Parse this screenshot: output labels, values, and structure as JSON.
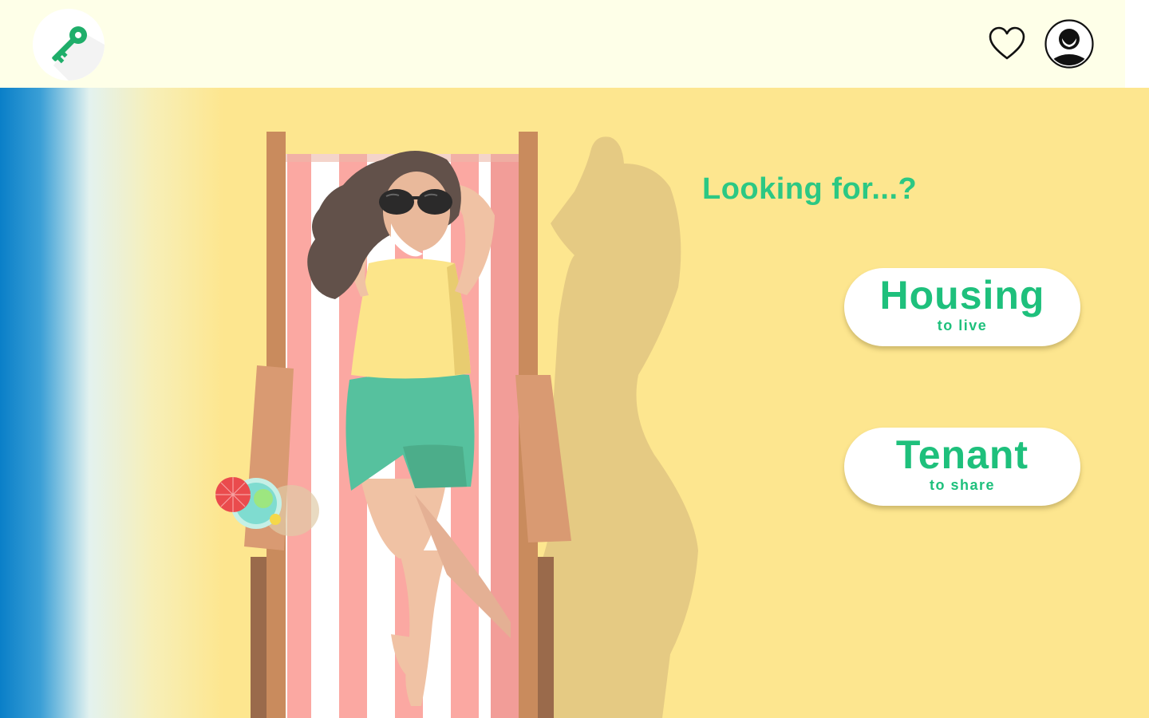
{
  "header": {
    "logo_icon": "key-icon",
    "favorites_icon": "heart-icon",
    "account_icon": "user-avatar-icon"
  },
  "main": {
    "heading": "Looking for...?",
    "options": [
      {
        "title": "Housing",
        "subtitle": "to live"
      },
      {
        "title": "Tenant",
        "subtitle": "to share"
      }
    ]
  },
  "colors": {
    "accent": "#2cc883",
    "header_bg": "#feffe8",
    "sand": "#fde68f",
    "sea": "#0a7fc8"
  }
}
